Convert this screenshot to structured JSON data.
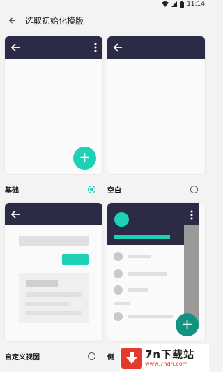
{
  "status": {
    "time": "11:14"
  },
  "header": {
    "title": "选取初始化模版"
  },
  "templates": [
    {
      "label": "基础",
      "selected": true,
      "fab": "+"
    },
    {
      "label": "空白",
      "selected": false
    },
    {
      "label": "自定义视图",
      "selected": false
    },
    {
      "label": "侧",
      "selected": false,
      "fab": "+"
    }
  ],
  "watermark": {
    "main": "7n下载站",
    "sub": "www.7ndn.com"
  },
  "colors": {
    "accent": "#1ed0b6",
    "toolbar": "#2c2b46",
    "brand": "#e23b2e"
  }
}
